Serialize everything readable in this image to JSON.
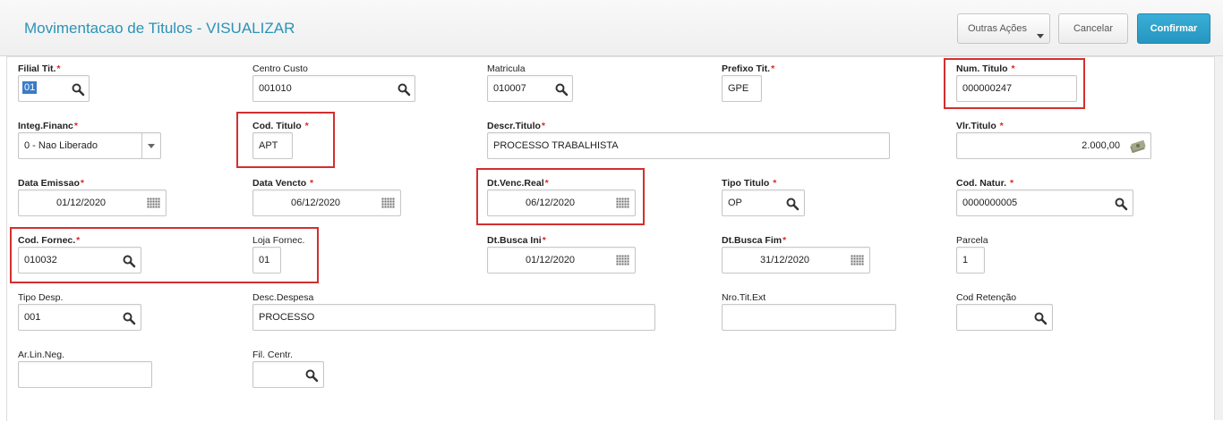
{
  "header": {
    "title": "Movimentacao de Titulos - VISUALIZAR",
    "buttons": {
      "outras": "Outras Ações",
      "cancel": "Cancelar",
      "confirm": "Confirmar"
    }
  },
  "fields": {
    "filial": {
      "label": "Filial Tit.",
      "req": "*",
      "value": "01"
    },
    "ccusto": {
      "label": "Centro Custo",
      "value": "001010"
    },
    "matric": {
      "label": "Matricula",
      "value": "010007"
    },
    "prefixo": {
      "label": "Prefixo Tit.",
      "req": "*",
      "value": "GPE"
    },
    "numtit": {
      "label": "Num. Titulo",
      "req": "*",
      "value": "000000247"
    },
    "integ": {
      "label": "Integ.Financ",
      "req": "*",
      "value": "0 - Nao Liberado"
    },
    "codtit": {
      "label": "Cod. Titulo",
      "req": "*",
      "value": "APT"
    },
    "descr": {
      "label": "Descr.Titulo",
      "req": "*",
      "value": "PROCESSO TRABALHISTA"
    },
    "vlr": {
      "label": "Vlr.Titulo",
      "req": "*",
      "value": "2.000,00"
    },
    "emissao": {
      "label": "Data Emissao",
      "req": "*",
      "value": "01/12/2020"
    },
    "vencto": {
      "label": "Data Vencto",
      "req": "*",
      "value": "06/12/2020"
    },
    "vencreal": {
      "label": "Dt.Venc.Real",
      "req": "*",
      "value": "06/12/2020"
    },
    "tipotit": {
      "label": "Tipo Titulo",
      "req": "*",
      "value": "OP"
    },
    "natur": {
      "label": "Cod. Natur.",
      "req": "*",
      "value": "0000000005"
    },
    "fornec": {
      "label": "Cod. Fornec.",
      "req": "*",
      "value": "010032"
    },
    "loja": {
      "label": "Loja Fornec.",
      "value": "01"
    },
    "buscaini": {
      "label": "Dt.Busca Ini",
      "req": "*",
      "value": "01/12/2020"
    },
    "buscafim": {
      "label": "Dt.Busca Fim",
      "req": "*",
      "value": "31/12/2020"
    },
    "parcela": {
      "label": "Parcela",
      "value": "1"
    },
    "tipodesp": {
      "label": "Tipo Desp.",
      "value": "001"
    },
    "descdesp": {
      "label": "Desc.Despesa",
      "value": "PROCESSO"
    },
    "nrotit": {
      "label": "Nro.Tit.Ext",
      "value": ""
    },
    "codret": {
      "label": "Cod Retenção",
      "value": ""
    },
    "arlin": {
      "label": "Ar.Lin.Neg.",
      "value": ""
    },
    "filcentr": {
      "label": "Fil. Centr.",
      "value": ""
    }
  },
  "icons": {
    "lookup": "search-icon",
    "date": "calendar-icon",
    "money": "money-icon",
    "dropdown": "chevron-down-icon"
  },
  "colors": {
    "title": "#2a93b8",
    "confirm_button": "#2596c1",
    "required": "#e02424",
    "highlight": "#d32f2f"
  }
}
